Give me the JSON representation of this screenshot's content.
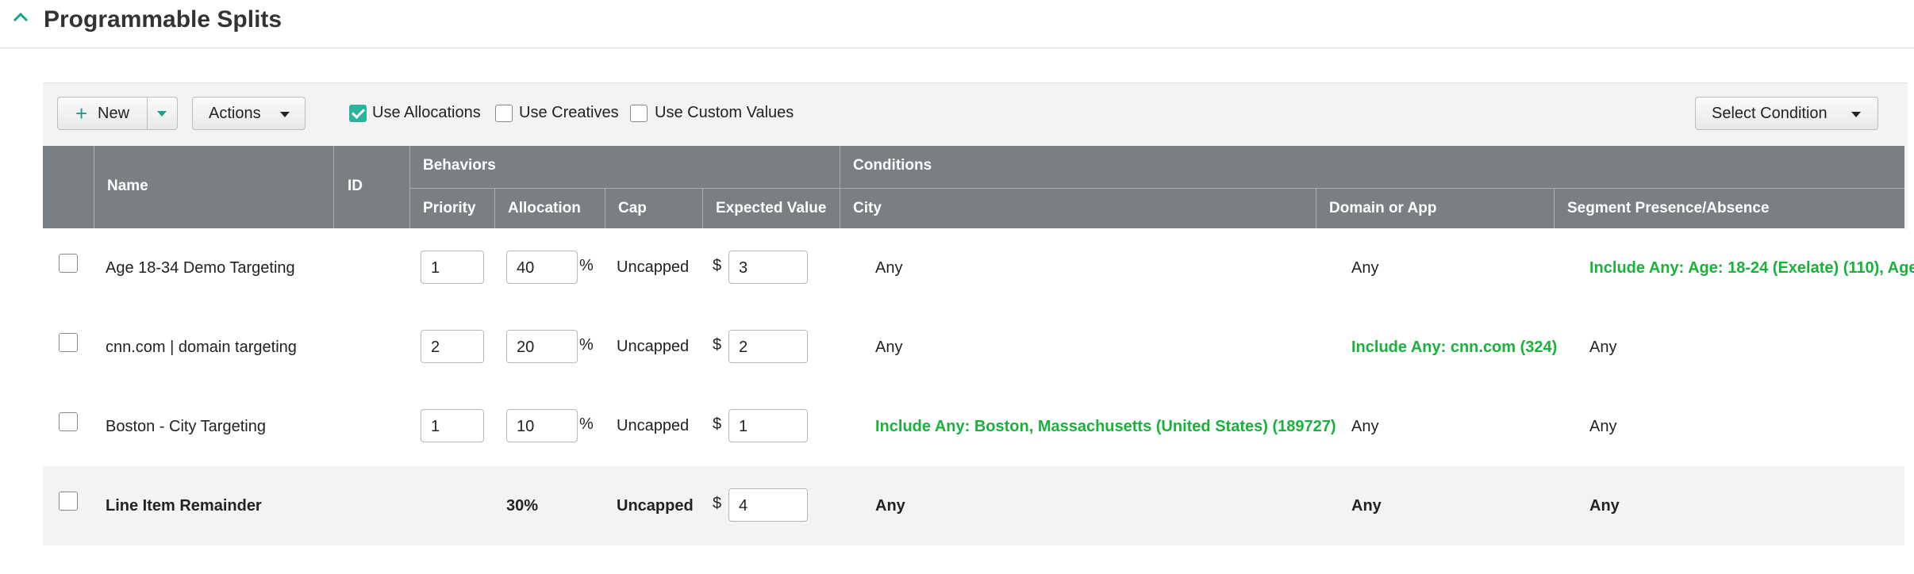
{
  "section": {
    "title": "Programmable Splits"
  },
  "toolbar": {
    "new_label": "New",
    "actions_label": "Actions",
    "use_allocations": {
      "label": "Use Allocations",
      "checked": true
    },
    "use_creatives": {
      "label": "Use Creatives",
      "checked": false
    },
    "use_custom_values": {
      "label": "Use Custom Values",
      "checked": false
    },
    "select_condition_label": "Select Condition"
  },
  "table": {
    "group_headers": {
      "behaviors": "Behaviors",
      "conditions": "Conditions"
    },
    "headers": {
      "name": "Name",
      "id": "ID",
      "priority": "Priority",
      "allocation": "Allocation",
      "cap": "Cap",
      "expected_value": "Expected Value",
      "city": "City",
      "domain": "Domain or App",
      "segment": "Segment Presence/Absence"
    },
    "rows": [
      {
        "name": "Age 18-34 Demo Targeting",
        "priority": "1",
        "allocation": "40",
        "pct": "%",
        "cap": "Uncapped",
        "currency": "$",
        "expected_value": "3",
        "city": "Any",
        "domain": "Any",
        "segment": "Include Any: Age: 18-24 (Exelate) (110), Age:"
      },
      {
        "name": "cnn.com | domain targeting",
        "priority": "2",
        "allocation": "20",
        "pct": "%",
        "cap": "Uncapped",
        "currency": "$",
        "expected_value": "2",
        "city": "Any",
        "domain": "Include Any: cnn.com (324)",
        "segment": "Any"
      },
      {
        "name": "Boston - City Targeting",
        "priority": "1",
        "allocation": "10",
        "pct": "%",
        "cap": "Uncapped",
        "currency": "$",
        "expected_value": "1",
        "city": "Include Any: Boston, Massachusetts (United States) (189727)",
        "domain": "Any",
        "segment": "Any"
      }
    ],
    "remainder": {
      "name": "Line Item Remainder",
      "allocation": "30%",
      "cap": "Uncapped",
      "currency": "$",
      "expected_value": "4",
      "city": "Any",
      "domain": "Any",
      "segment": "Any"
    }
  },
  "colors": {
    "header_bg": "#7a7f84",
    "accent": "#2ab5a0",
    "condition_green": "#18b23a"
  }
}
